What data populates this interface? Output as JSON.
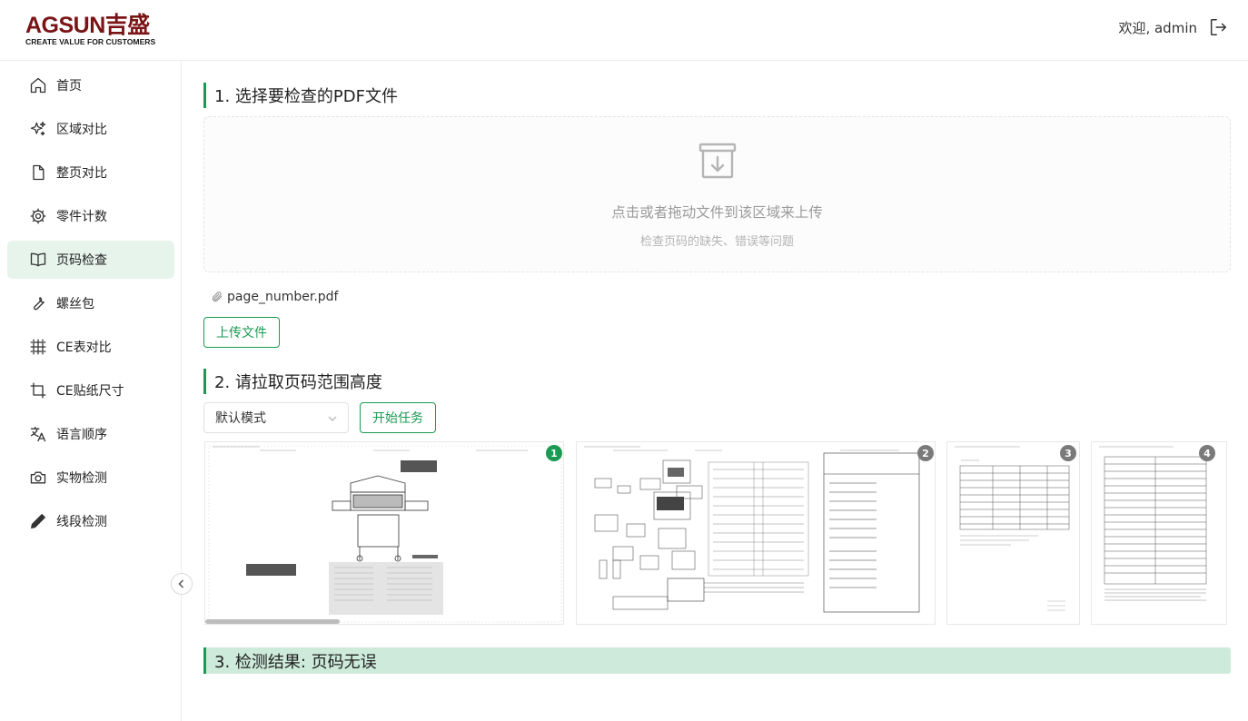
{
  "header": {
    "logo_main": "AGSUN吉盛",
    "logo_sub": "CREATE VALUE FOR CUSTOMERS",
    "welcome": "欢迎, admin",
    "logout_icon": "logout-icon"
  },
  "sidebar": {
    "items": [
      {
        "label": "首页",
        "icon": "home-icon"
      },
      {
        "label": "区域对比",
        "icon": "sparkle-icon"
      },
      {
        "label": "整页对比",
        "icon": "file-icon"
      },
      {
        "label": "零件计数",
        "icon": "gear-icon"
      },
      {
        "label": "页码检查",
        "icon": "book-icon",
        "active": true
      },
      {
        "label": "螺丝包",
        "icon": "wrench-icon"
      },
      {
        "label": "CE表对比",
        "icon": "grid-icon"
      },
      {
        "label": "CE贴纸尺寸",
        "icon": "crop-icon"
      },
      {
        "label": "语言顺序",
        "icon": "translate-icon"
      },
      {
        "label": "实物检测",
        "icon": "camera-icon"
      },
      {
        "label": "线段检测",
        "icon": "pen-icon"
      }
    ],
    "collapse_icon": "chevron-left-icon"
  },
  "main": {
    "step1_title": "1. 选择要检查的PDF文件",
    "dropzone_text": "点击或者拖动文件到该区域来上传",
    "dropzone_hint": "检查页码的缺失、错误等问题",
    "file_name": "page_number.pdf",
    "upload_button": "上传文件",
    "step2_title": "2. 请拉取页码范围高度",
    "mode_select": "默认模式",
    "start_button": "开始任务",
    "pages": [
      "1",
      "2",
      "3",
      "4"
    ],
    "result": "3. 检测结果: 页码无误"
  },
  "colors": {
    "accent": "#1a9a52",
    "active_bg": "#e6f4ec",
    "result_bg": "#cdeadb",
    "logo": "#7a1416"
  }
}
